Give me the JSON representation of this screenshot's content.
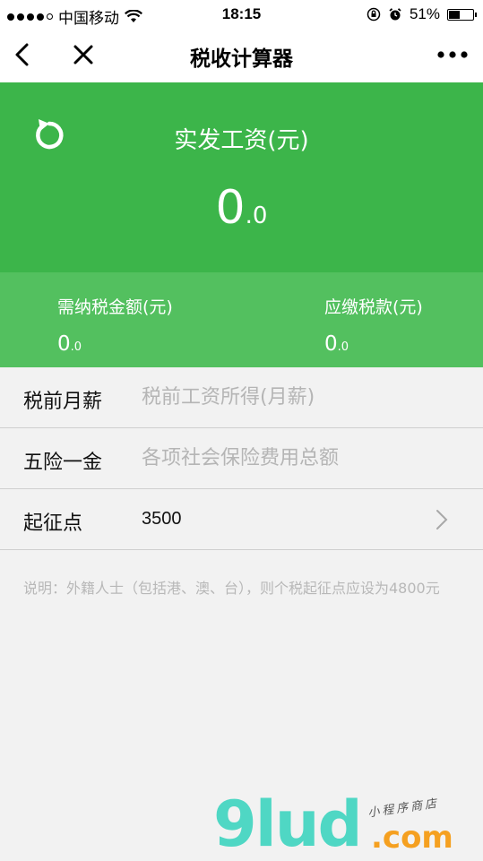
{
  "status_bar": {
    "carrier": "中国移动",
    "time": "18:15",
    "battery": "51%",
    "battery_level": 0.51
  },
  "nav": {
    "title": "税收计算器",
    "back_icon": "chevron-left-icon",
    "close_icon": "close-icon",
    "more_icon": "more-dots-icon"
  },
  "hero": {
    "label": "实发工资(元)",
    "amount_int": "0",
    "amount_dec": ".0",
    "refresh_icon": "refresh-icon"
  },
  "summary": {
    "tax_label": "需纳税金额(元)",
    "tax_int": "0",
    "tax_dec": ".0",
    "payable_label": "应缴税款(元)",
    "payable_int": "0",
    "payable_dec": ".0"
  },
  "form": {
    "salary_label": "税前月薪",
    "salary_placeholder": "税前工资所得(月薪)",
    "insurance_label": "五险一金",
    "insurance_placeholder": "各项社会保险费用总额",
    "threshold_label": "起征点",
    "threshold_value": "3500"
  },
  "note": "说明：外籍人士（包括港、澳、台），则个税起征点应设为4800元",
  "watermark": {
    "brand": "9lud",
    "domain": ".com",
    "tagline": "小程序商店"
  },
  "colors": {
    "primary": "#3cb54a",
    "secondary": "#53c05f",
    "background": "#f2f2f2"
  }
}
